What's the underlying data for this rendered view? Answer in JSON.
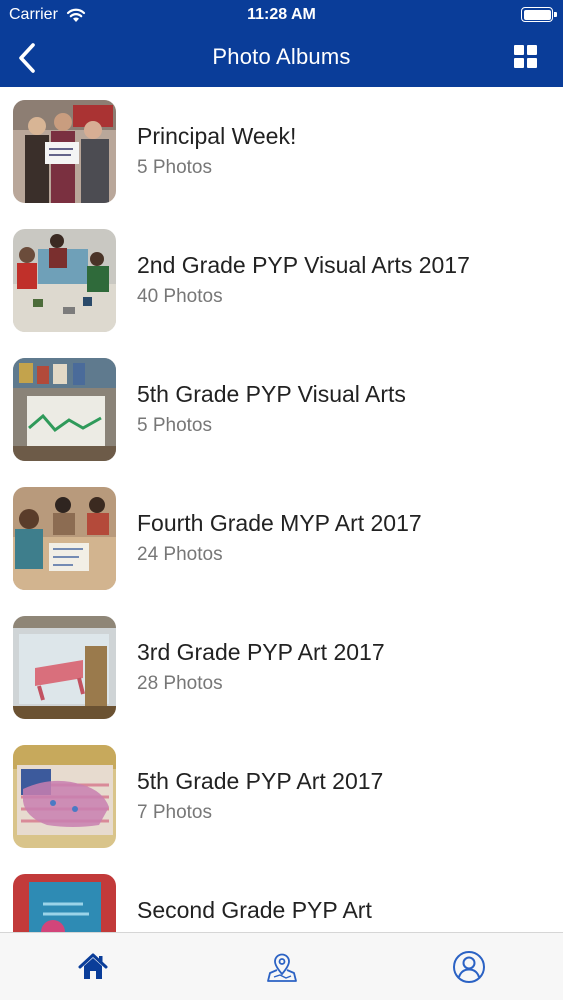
{
  "status_bar": {
    "carrier": "Carrier",
    "time": "11:28 AM"
  },
  "nav": {
    "title": "Photo Albums",
    "back_icon": "chevron-left-icon",
    "view_toggle_icon": "grid-icon"
  },
  "albums": [
    {
      "title": "Principal Week!",
      "count": "5 Photos"
    },
    {
      "title": "2nd Grade PYP Visual Arts 2017",
      "count": "40 Photos"
    },
    {
      "title": "5th Grade PYP Visual Arts",
      "count": "5 Photos"
    },
    {
      "title": "Fourth Grade MYP Art 2017",
      "count": "24 Photos"
    },
    {
      "title": "3rd Grade PYP Art 2017",
      "count": "28 Photos"
    },
    {
      "title": "5th Grade PYP Art 2017",
      "count": "7 Photos"
    },
    {
      "title": "Second Grade PYP Art",
      "count": ""
    }
  ],
  "tab_bar": {
    "items": [
      {
        "icon": "home-icon",
        "active": true
      },
      {
        "icon": "map-pin-icon",
        "active": false
      },
      {
        "icon": "user-profile-icon",
        "active": false
      }
    ]
  },
  "colors": {
    "brand": "#0a3d99",
    "title_text": "#222222",
    "count_text": "#777777",
    "tab_active": "#0a3d99",
    "tab_inactive": "#2b62c4"
  }
}
